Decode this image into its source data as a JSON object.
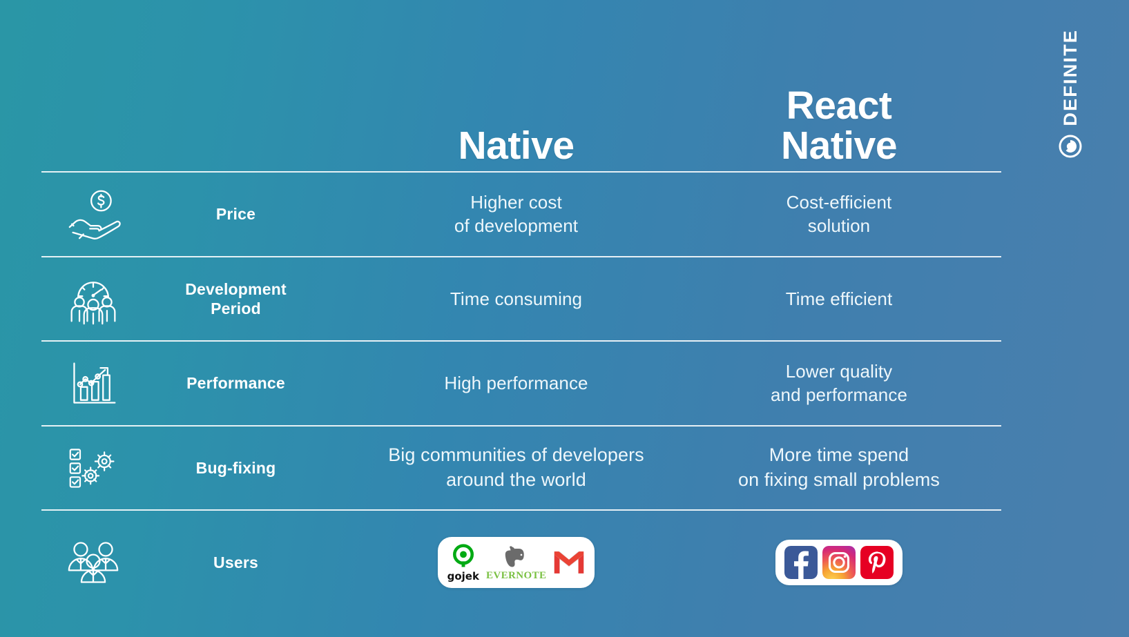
{
  "brand": {
    "name": "DEFINITE",
    "mark_icon": "definite-circle-logo"
  },
  "table": {
    "headers": {
      "label_column": "",
      "column_a": "Native",
      "column_b_line1": "React",
      "column_b_line2": "Native"
    },
    "rows": [
      {
        "id": "price",
        "icon": "hand-holding-coin-icon",
        "label": "Price",
        "native_line1": "Higher cost",
        "native_line2": "of development",
        "react_line1": "Cost-efficient",
        "react_line2": "solution"
      },
      {
        "id": "development-period",
        "icon": "clock-team-icon",
        "label_line1": "Development",
        "label_line2": "Period",
        "native_line1": "Time consuming",
        "native_line2": "",
        "react_line1": "Time efficient",
        "react_line2": ""
      },
      {
        "id": "performance",
        "icon": "bar-chart-growth-icon",
        "label": "Performance",
        "native_line1": "High performance",
        "native_line2": "",
        "react_line1": "Lower quality",
        "react_line2": "and performance"
      },
      {
        "id": "bug-fixing",
        "icon": "checklist-gears-icon",
        "label": "Bug-fixing",
        "native_line1": "Big communities of developers",
        "native_line2": "around the world",
        "react_line1": "More time spend",
        "react_line2": "on fixing small problems"
      },
      {
        "id": "users",
        "icon": "group-people-icon",
        "label": "Users",
        "native_logos": [
          {
            "name": "gojek",
            "word": "gojek",
            "icon": "gojek-logo",
            "color": "#00aa13"
          },
          {
            "name": "evernote",
            "word": "EVERNOTE",
            "icon": "evernote-elephant-logo",
            "color": "#7ac143"
          },
          {
            "name": "gmail",
            "word": "",
            "icon": "gmail-envelope-logo",
            "color": "#ea4335"
          }
        ],
        "react_logos": [
          {
            "name": "facebook",
            "icon": "facebook-logo",
            "color": "#3b5998"
          },
          {
            "name": "instagram",
            "icon": "instagram-logo",
            "color": "#d62976"
          },
          {
            "name": "pinterest",
            "icon": "pinterest-logo",
            "color": "#e60023"
          }
        ]
      }
    ]
  },
  "theme": {
    "bg_left": "#2a96a6",
    "bg_right": "#4a7fad",
    "text_primary": "#ffffff",
    "text_value": "#eef7fb",
    "rule": "#ffffff"
  }
}
